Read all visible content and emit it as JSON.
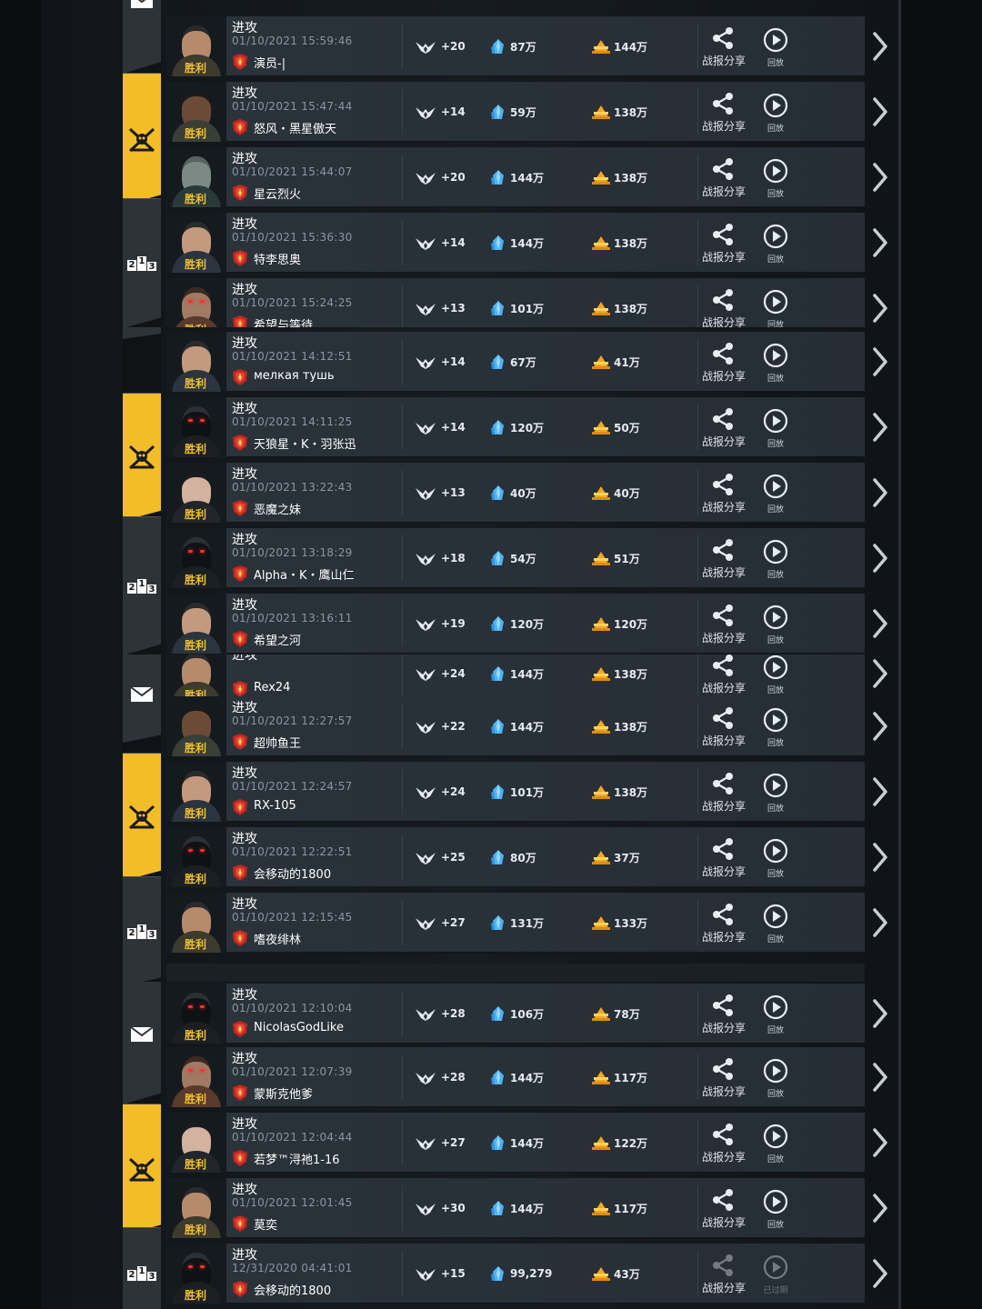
{
  "labels": {
    "win": "胜利",
    "attack": "进攻",
    "share": "战报分享",
    "replay": "回放",
    "expired": "已过期"
  },
  "colors": {
    "accent_yellow": "#f3bd28",
    "tab_gray": "#2e3338",
    "win_text": "#f2c230"
  },
  "icons": {
    "tabs": [
      "mail-icon",
      "crossed-swords-icon",
      "podium-rank-icon"
    ],
    "stats": [
      "wings-trophy-icon",
      "crystal-icon",
      "gold-icon"
    ],
    "actions": [
      "share-icon",
      "play-circle-icon",
      "chevron-right-icon"
    ]
  },
  "segments": [
    {
      "rows": [
        {
          "time": "01/10/2021 15:59:46",
          "player": "演员-|",
          "trophy": "+20",
          "crystal": "87万",
          "gold": "144万"
        },
        {
          "time": "01/10/2021 15:47:44",
          "player": "怒风・黑星傲天",
          "trophy": "+14",
          "crystal": "59万",
          "gold": "138万"
        },
        {
          "time": "01/10/2021 15:44:07",
          "player": "星云烈火",
          "trophy": "+20",
          "crystal": "144万",
          "gold": "138万"
        },
        {
          "time": "01/10/2021 15:36:30",
          "player": "特李思奥",
          "trophy": "+14",
          "crystal": "144万",
          "gold": "138万"
        },
        {
          "time": "01/10/2021 15:24:25",
          "player": "希望与等待",
          "trophy": "+13",
          "crystal": "101万",
          "gold": "138万"
        }
      ]
    },
    {
      "rows": [
        {
          "time": "01/10/2021 14:12:51",
          "player": "мелкая тушь",
          "trophy": "+14",
          "crystal": "67万",
          "gold": "41万"
        },
        {
          "time": "01/10/2021 14:11:25",
          "player": "天狼星・K・羽张迅",
          "trophy": "+14",
          "crystal": "120万",
          "gold": "50万"
        },
        {
          "time": "01/10/2021 13:22:43",
          "player": "恶魔之妹",
          "trophy": "+13",
          "crystal": "40万",
          "gold": "40万"
        },
        {
          "time": "01/10/2021 13:18:29",
          "player": "Alpha・K・鹰山仁",
          "trophy": "+18",
          "crystal": "54万",
          "gold": "51万"
        },
        {
          "time": "01/10/2021 13:16:11",
          "player": "希望之河",
          "trophy": "+19",
          "crystal": "120万",
          "gold": "120万"
        }
      ]
    },
    {
      "rows": [
        {
          "time": "",
          "player": "Rex24",
          "trophy": "+24",
          "crystal": "144万",
          "gold": "138万"
        },
        {
          "time": "01/10/2021 12:27:57",
          "player": "超帅鱼王",
          "trophy": "+22",
          "crystal": "144万",
          "gold": "138万"
        },
        {
          "time": "01/10/2021 12:24:57",
          "player": "RX-105",
          "trophy": "+24",
          "crystal": "101万",
          "gold": "138万"
        },
        {
          "time": "01/10/2021 12:22:51",
          "player": "会移动的1800",
          "trophy": "+25",
          "crystal": "80万",
          "gold": "37万"
        },
        {
          "time": "01/10/2021 12:15:45",
          "player": "嗜夜绯林",
          "trophy": "+27",
          "crystal": "131万",
          "gold": "133万"
        }
      ]
    },
    {
      "rows": [
        {
          "time": "01/10/2021 12:10:04",
          "player": "NicolasGodLike",
          "trophy": "+28",
          "crystal": "106万",
          "gold": "78万"
        },
        {
          "time": "01/10/2021 12:07:39",
          "player": "蒙斯克他爹",
          "trophy": "+28",
          "crystal": "144万",
          "gold": "117万"
        },
        {
          "time": "01/10/2021 12:04:44",
          "player": "若梦™浔祂1-16",
          "trophy": "+27",
          "crystal": "144万",
          "gold": "122万"
        },
        {
          "time": "01/10/2021 12:01:45",
          "player": "莫奕",
          "trophy": "+30",
          "crystal": "144万",
          "gold": "117万"
        },
        {
          "time": "12/31/2020 04:41:01",
          "player": "会移动的1800",
          "trophy": "+15",
          "crystal": "99,279",
          "gold": "43万",
          "expired": true
        }
      ]
    }
  ]
}
